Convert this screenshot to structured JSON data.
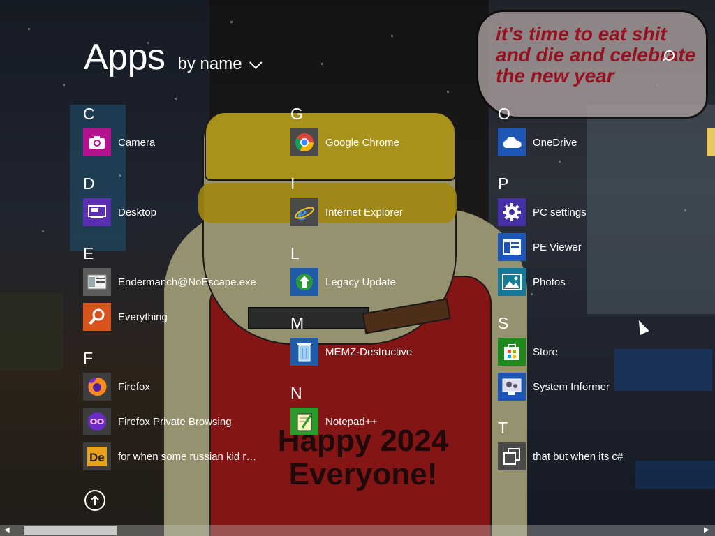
{
  "header": {
    "title": "Apps",
    "sort_label": "by name"
  },
  "wallpaper": {
    "speech": [
      "it's time to eat shit",
      "and die and celebrate",
      "the new year"
    ],
    "caption_line1": "Happy 2024",
    "caption_line2": "Everyone!"
  },
  "groups": [
    {
      "letter": "C",
      "apps": [
        {
          "label": "Camera",
          "icon": "camera-icon",
          "color": "#b4128f"
        }
      ]
    },
    {
      "letter": "D",
      "apps": [
        {
          "label": "Desktop",
          "icon": "desktop-icon",
          "color": "#5a2fb2"
        }
      ]
    },
    {
      "letter": "E",
      "apps": [
        {
          "label": "Endermanch@NoEscape.exe",
          "icon": "window-app-icon",
          "color": "#5c5c5c"
        },
        {
          "label": "Everything",
          "icon": "magnifier-icon",
          "color": "#d9541c"
        }
      ]
    },
    {
      "letter": "F",
      "apps": [
        {
          "label": "Firefox",
          "icon": "firefox-icon",
          "color": "#3d3d3d"
        },
        {
          "label": "Firefox Private Browsing",
          "icon": "firefox-private-icon",
          "color": "#3d3d3d"
        },
        {
          "label": "for when some russian kid runs t...",
          "icon": "de-icon",
          "color": "#3d3d3d"
        }
      ]
    },
    {
      "letter": "G",
      "apps": [
        {
          "label": "Google Chrome",
          "icon": "chrome-icon",
          "color": "#4a4a4a"
        }
      ]
    },
    {
      "letter": "I",
      "apps": [
        {
          "label": "Internet Explorer",
          "icon": "ie-icon",
          "color": "#4a4a4a"
        }
      ]
    },
    {
      "letter": "L",
      "apps": [
        {
          "label": "Legacy Update",
          "icon": "legacy-update-icon",
          "color": "#1f5ba8"
        }
      ]
    },
    {
      "letter": "M",
      "apps": [
        {
          "label": "MEMZ-Destructive",
          "icon": "recycle-bin-icon",
          "color": "#1f5ba8"
        }
      ]
    },
    {
      "letter": "N",
      "apps": [
        {
          "label": "Notepad++",
          "icon": "notepad-plus-icon",
          "color": "#2a9a2a"
        }
      ]
    },
    {
      "letter": "O",
      "apps": [
        {
          "label": "OneDrive",
          "icon": "onedrive-icon",
          "color": "#1e56b8"
        }
      ]
    },
    {
      "letter": "P",
      "apps": [
        {
          "label": "PC settings",
          "icon": "gear-icon",
          "color": "#4630a8"
        },
        {
          "label": "PE Viewer",
          "icon": "pe-viewer-icon",
          "color": "#1e56b8"
        },
        {
          "label": "Photos",
          "icon": "photos-icon",
          "color": "#137a9a"
        }
      ]
    },
    {
      "letter": "S",
      "apps": [
        {
          "label": "Store",
          "icon": "store-icon",
          "color": "#1e8a1e"
        },
        {
          "label": "System Informer",
          "icon": "system-informer-icon",
          "color": "#1e56b8"
        }
      ]
    },
    {
      "letter": "T",
      "apps": [
        {
          "label": "that but when its c#",
          "icon": "generic-app-icon",
          "color": "#4a4a4a"
        }
      ]
    }
  ]
}
